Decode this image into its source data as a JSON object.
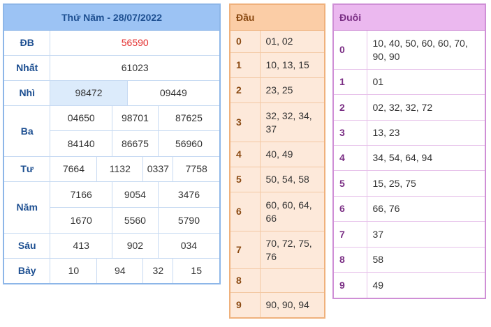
{
  "results": {
    "date_title": "Thứ Năm - 28/07/2022",
    "labels": {
      "db": "ĐB",
      "nhat": "Nhất",
      "nhi": "Nhì",
      "ba": "Ba",
      "tu": "Tư",
      "nam": "Năm",
      "sau": "Sáu",
      "bay": "Bảy"
    },
    "db": "56590",
    "nhat": "61023",
    "nhi": [
      "98472",
      "09449"
    ],
    "ba": [
      "04650",
      "98701",
      "87625",
      "84140",
      "86675",
      "56960"
    ],
    "tu": [
      "7664",
      "1132",
      "0337",
      "7758"
    ],
    "nam": [
      "7166",
      "9054",
      "3476",
      "1670",
      "5560",
      "5790"
    ],
    "sau": [
      "413",
      "902",
      "034"
    ],
    "bay": [
      "10",
      "94",
      "32",
      "15"
    ]
  },
  "dau": {
    "header": "Đầu",
    "rows": [
      {
        "key": "0",
        "value": "01, 02"
      },
      {
        "key": "1",
        "value": "10, 13, 15"
      },
      {
        "key": "2",
        "value": "23, 25"
      },
      {
        "key": "3",
        "value": "32, 32, 34, 37"
      },
      {
        "key": "4",
        "value": "40, 49"
      },
      {
        "key": "5",
        "value": "50, 54, 58"
      },
      {
        "key": "6",
        "value": "60, 60, 64, 66"
      },
      {
        "key": "7",
        "value": "70, 72, 75, 76"
      },
      {
        "key": "8",
        "value": ""
      },
      {
        "key": "9",
        "value": "90, 90, 94"
      }
    ]
  },
  "duoi": {
    "header": "Đuôi",
    "rows": [
      {
        "key": "0",
        "value": "10, 40, 50, 60, 60, 70, 90, 90"
      },
      {
        "key": "1",
        "value": "01"
      },
      {
        "key": "2",
        "value": "02, 32, 32, 72"
      },
      {
        "key": "3",
        "value": "13, 23"
      },
      {
        "key": "4",
        "value": "34, 54, 64, 94"
      },
      {
        "key": "5",
        "value": "15, 25, 75"
      },
      {
        "key": "6",
        "value": "66, 76"
      },
      {
        "key": "7",
        "value": "37"
      },
      {
        "key": "8",
        "value": "58"
      },
      {
        "key": "9",
        "value": "49"
      }
    ]
  },
  "colors": {
    "special_prize": "#e32d2d",
    "results_header": "#9cc3f4",
    "dau_header": "#fbcda6",
    "dau_body": "#fde9da",
    "duoi_header": "#ebb8ef"
  }
}
